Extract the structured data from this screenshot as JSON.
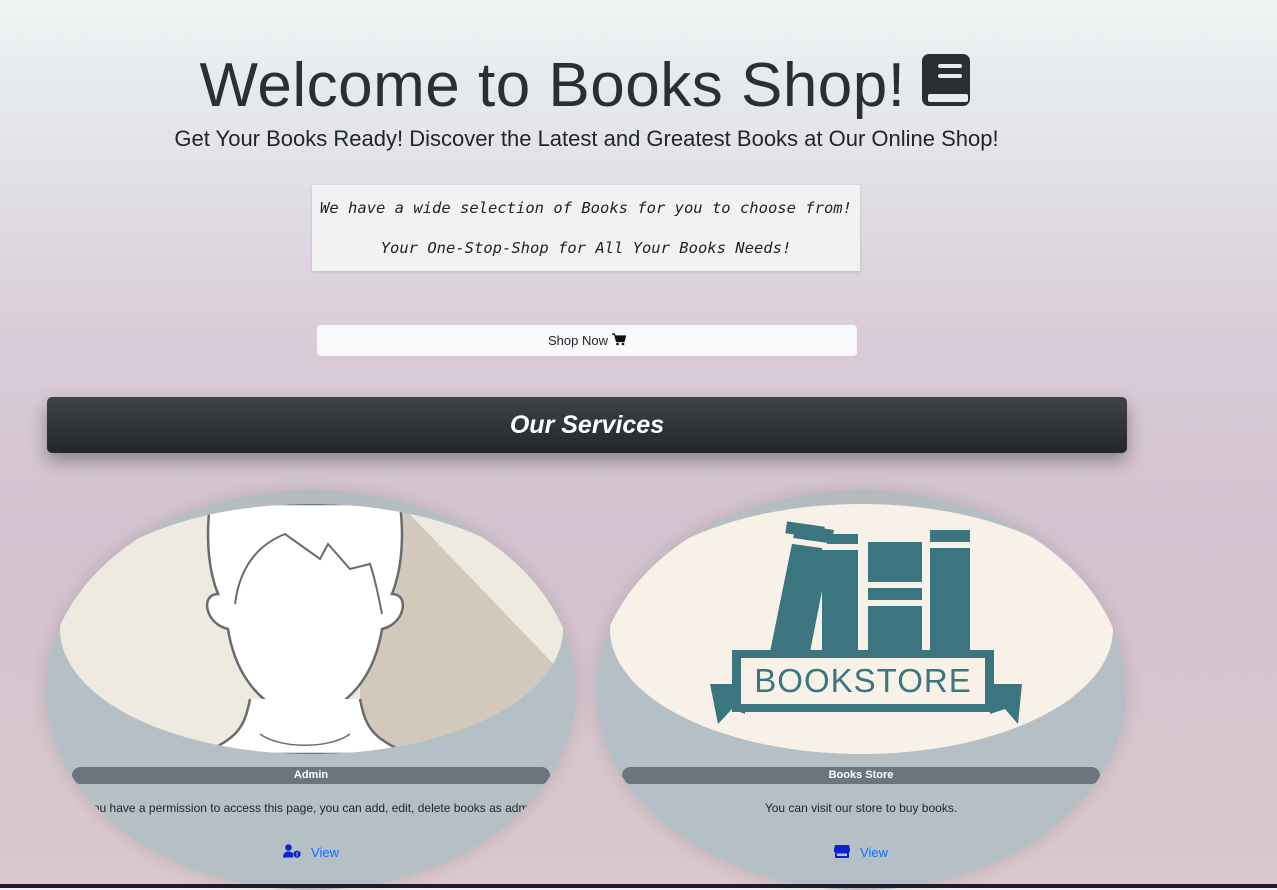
{
  "hero": {
    "title": "Welcome to Books Shop!",
    "subtitle": "Get Your Books Ready! Discover the Latest and Greatest Books at Our Online Shop!"
  },
  "quote": {
    "line1": "We have a wide selection of Books for you to choose from!",
    "line2": "Your One-Stop-Shop for All Your Books Needs!"
  },
  "shop_button": {
    "label": "Shop Now"
  },
  "services": {
    "heading": "Our Services"
  },
  "cards": [
    {
      "title": "Admin",
      "description": "If you have a permission to access this page, you can add, edit, delete books as admin.}",
      "link_label": "View",
      "icon": "user-shield-icon"
    },
    {
      "title": "Books Store",
      "description": "You can visit our store to buy books.",
      "link_label": "View",
      "icon": "store-icon",
      "logo_text": "BOOKSTORE"
    }
  ],
  "colors": {
    "services_bar": "#23272b",
    "pill": "#6c757d",
    "card_bg": "#b4c0c5",
    "link": "#0d6efd",
    "bookstore_teal": "#3a7580"
  }
}
